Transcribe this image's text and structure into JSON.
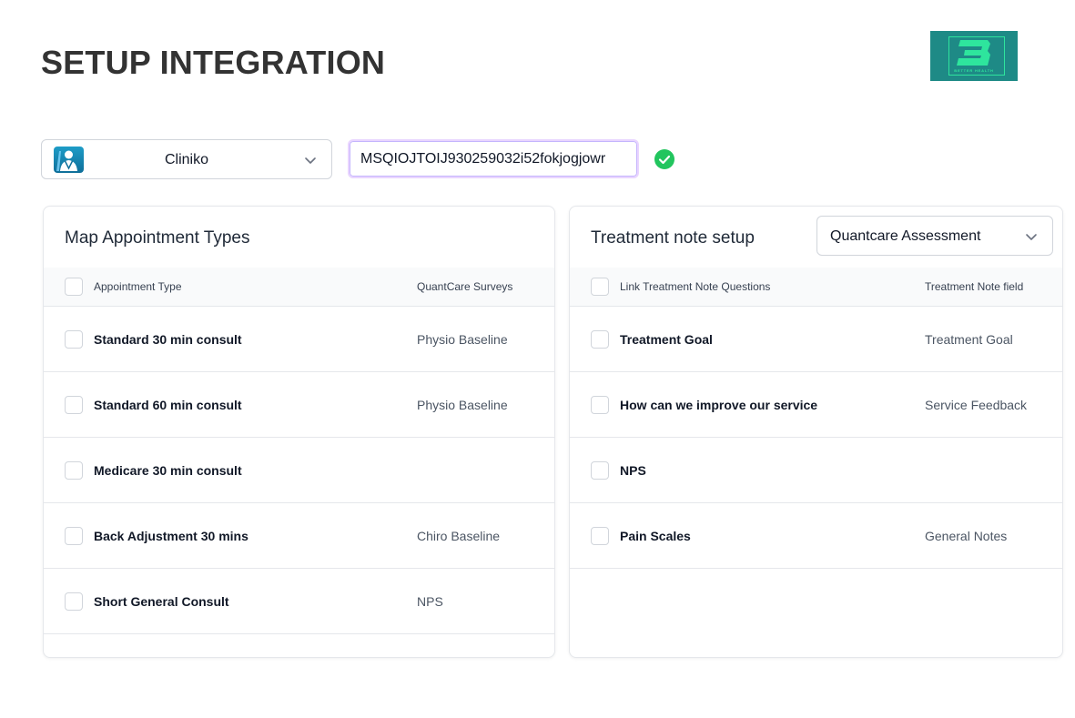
{
  "page": {
    "title": "SETUP INTEGRATION"
  },
  "logo": {
    "letter": "B",
    "tagline": "BETTER HEALTH"
  },
  "integration": {
    "selected": "Cliniko",
    "api_key": "MSQIOJTOIJ930259032i52fokjogjowr",
    "status_icon": "check-circle-icon",
    "accent": "#22c55e"
  },
  "appointments": {
    "title": "Map Appointment Types",
    "headers": {
      "type": "Appointment Type",
      "survey": "QuantCare Surveys"
    },
    "rows": [
      {
        "type": "Standard 30 min consult",
        "survey": "Physio Baseline"
      },
      {
        "type": "Standard 60 min consult",
        "survey": "Physio Baseline"
      },
      {
        "type": "Medicare 30 min consult",
        "survey": ""
      },
      {
        "type": "Back Adjustment 30 mins",
        "survey": "Chiro Baseline"
      },
      {
        "type": "Short General Consult",
        "survey": "NPS"
      }
    ]
  },
  "treatment": {
    "title": "Treatment note setup",
    "template_selected": "Quantcare Assessment",
    "headers": {
      "question": "Link Treatment Note Questions",
      "field": "Treatment Note field"
    },
    "rows": [
      {
        "question": "Treatment Goal",
        "field": "Treatment Goal"
      },
      {
        "question": "How can we improve our service",
        "field": "Service Feedback"
      },
      {
        "question": "NPS",
        "field": ""
      },
      {
        "question": "Pain Scales",
        "field": "General Notes"
      }
    ]
  }
}
